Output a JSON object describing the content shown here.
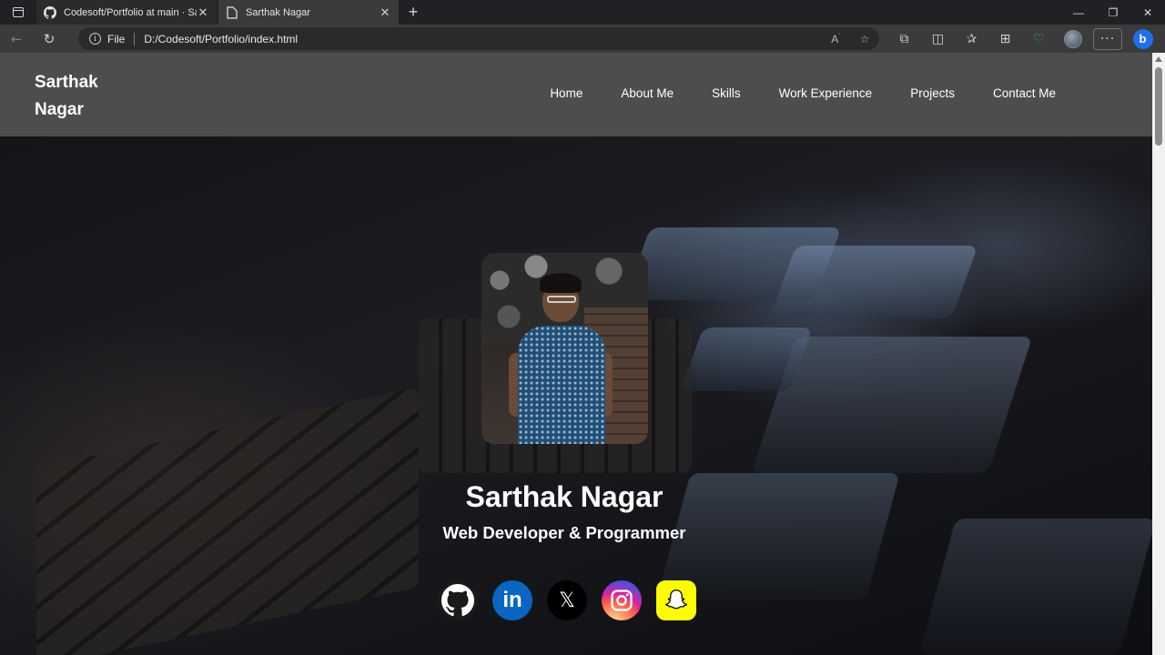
{
  "browser": {
    "tabs": [
      {
        "title": "Codesoft/Portfolio at main · Sarthak",
        "icon": "github-icon",
        "active": false
      },
      {
        "title": "Sarthak Nagar",
        "icon": "page-icon",
        "active": true
      }
    ],
    "address": {
      "scheme_label": "File",
      "url": "D:/Codesoft/Portfolio/index.html"
    }
  },
  "site": {
    "brand": "Sarthak Nagar",
    "nav": [
      "Home",
      "About Me",
      "Skills",
      "Work Experience",
      "Projects",
      "Contact Me"
    ],
    "hero": {
      "name": "Sarthak Nagar",
      "role": "Web Developer & Programmer"
    },
    "socials": [
      "github",
      "linkedin",
      "x",
      "instagram",
      "snapchat"
    ]
  },
  "colors": {
    "header_bg": "#4d4d4d",
    "linkedin": "#0a66c2",
    "snapchat": "#fffc00"
  }
}
